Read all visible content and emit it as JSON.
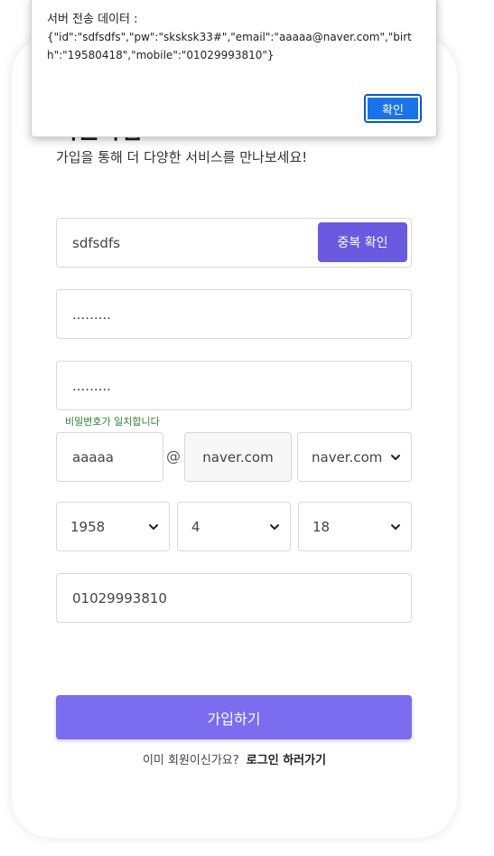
{
  "form": {
    "title": "회원가입",
    "subtitle": "가입을 통해 더 다양한 서비스를 만나보세요!",
    "user_id": "sdfsdfs",
    "dup_check_label": "중복 확인",
    "password_masked": ".........",
    "password_confirm_masked": ".........",
    "password_match_msg": "비밀번호가 일치합니다",
    "email_local": "aaaaa",
    "email_at": "@",
    "email_domain": "naver.com",
    "email_domain_select": "naver.com",
    "birth_year": "1958",
    "birth_month": "4",
    "birth_day": "18",
    "mobile": "01029993810",
    "submit_label": "가입하기",
    "login_prompt": "이미 회원이신가요?",
    "login_link": "로그인 하러가기"
  },
  "alert": {
    "title": "서버 전송 데이터 :",
    "body": "{\"id\":\"sdfsdfs\",\"pw\":\"sksksk33#\",\"email\":\"aaaaa@naver.com\",\"birth\":\"19580418\",\"mobile\":\"01029993810\"}",
    "ok_label": "확인"
  },
  "colors": {
    "accent": "#6a5ae0",
    "submit": "#7b6cf0",
    "alert_button": "#1a73e8",
    "match_text": "#2e7d32"
  }
}
